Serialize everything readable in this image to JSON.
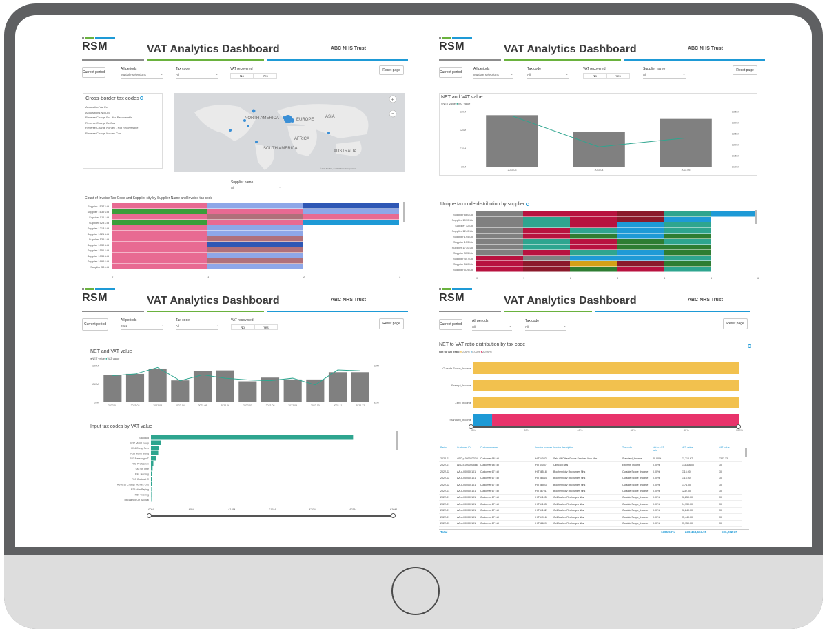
{
  "brand": {
    "logo": "RSM",
    "colors": {
      "grey": "#8d8d8d",
      "green": "#6ab23e",
      "blue": "#1e9ad6",
      "bar": "#808080",
      "line": "#2ea58f"
    }
  },
  "panels": [
    {
      "title": "VAT Analytics Dashboard",
      "trust": "ABC NHS Trust",
      "current_period_btn": "Current period",
      "reset_btn": "Reset page",
      "filters": [
        {
          "label": "All periods",
          "value": "Multiple selections"
        },
        {
          "label": "Tax code",
          "value": "All"
        }
      ],
      "vat_recovered": {
        "label": "VAT recovered",
        "options": [
          "No",
          "Yes"
        ]
      },
      "cross_border": {
        "title": "Cross-border tax codes",
        "items": [
          "Acquisition Vat Ec",
          "Acquisitions Non-ec",
          "Reverse Charge Ec - Not Recoverable",
          "Reverse Charge Ec Cos",
          "Reverse Charge Non-ec - Not Recoverable",
          "Reverse Charge Non-ec Cos"
        ]
      },
      "map_labels": [
        "NORTH AMERICA",
        "EUROPE",
        "ASIA",
        "AFRICA",
        "SOUTH AMERICA",
        "AUSTRALIA"
      ],
      "map_copyright": "© 2023 TomTom, © 2023 Microsoft Corporation",
      "supplier_filter": {
        "label": "Supplier name",
        "value": "All"
      },
      "stack_title": "Count of Invoice Tax Code and Supplier city by Supplier Name and Invoice tax code",
      "stack_rows": [
        "Supplier 1137 Ltd",
        "Supplier 1639 Ltd",
        "Supplier 511 Ltd",
        "Supplier 523 Ltd",
        "Supplier 1213 Ltd",
        "Supplier 1021 Ltd",
        "Supplier 135 Ltd",
        "Supplier 1030 Ltd",
        "Supplier 1551 Ltd",
        "Supplier 1035 Ltd",
        "Supplier 1695 Ltd",
        "Supplier 33 Ltd"
      ],
      "stack_axis": [
        "0",
        "1",
        "2",
        "3"
      ]
    },
    {
      "title": "VAT Analytics Dashboard",
      "trust": "ABC NHS Trust",
      "current_period_btn": "Current period",
      "reset_btn": "Reset page",
      "filters": [
        {
          "label": "All periods",
          "value": "Multiple selections"
        },
        {
          "label": "Tax code",
          "value": "All"
        },
        {
          "label": "Supplier name",
          "value": "All"
        }
      ],
      "vat_recovered": {
        "label": "VAT recovered",
        "options": [
          "No",
          "Yes"
        ]
      },
      "chart_title": "NET and VAT value",
      "legend": [
        "NET value",
        "VAT value"
      ],
      "unique_title": "Unique tax code distribution by supplier",
      "unique_rows": [
        "Supplier 860 Ltd",
        "Supplier 1090 Ltd",
        "Supplier 12 Ltd",
        "Supplier 1240 Ltd",
        "Supplier 195 Ltd",
        "Supplier 153 Ltd",
        "Supplier 1730 Ltd",
        "Supplier 335 Ltd",
        "Supplier 447 Ltd",
        "Supplier 580 Ltd",
        "Supplier 579 Ltd"
      ],
      "unique_axis": [
        "0",
        "1",
        "2",
        "3",
        "4",
        "5",
        "6"
      ]
    },
    {
      "title": "VAT Analytics Dashboard",
      "trust": "ABC NHS Trust",
      "current_period_btn": "Current period",
      "reset_btn": "Reset page",
      "filters": [
        {
          "label": "All periods",
          "value": "2022"
        },
        {
          "label": "Tax code",
          "value": "All"
        }
      ],
      "vat_recovered": {
        "label": "VAT recovered",
        "options": [
          "No",
          "Yes"
        ]
      },
      "chart_title": "NET and VAT value",
      "legend": [
        "NET value",
        "VAT value"
      ],
      "hbar_title": "Input tax codes by VAT value",
      "hbar_rows": [
        "Standard",
        "R37 Maint Equip",
        "R14 Comp Serv",
        "R35 Maint Bldng",
        "R47 Passenger T",
        "R42 Profession",
        "Out Of Time",
        "R41 Nursing",
        "R13 Contract C",
        "Reverse Charge Non-ec Cos",
        "R25 Hire Paying",
        "R50 Training",
        "Reclaimed On Accrual"
      ],
      "hbar_axis": [
        "£0M",
        "£5M",
        "£10M",
        "£15M",
        "£20M",
        "£25M",
        "£30M"
      ]
    },
    {
      "title": "VAT Analytics Dashboard",
      "trust": "ABC NHS Trust",
      "current_period_btn": "Current period",
      "reset_btn": "Reset page",
      "filters": [
        {
          "label": "All periods",
          "value": "All"
        },
        {
          "label": "Tax code",
          "value": "All"
        }
      ],
      "ratio_title": "NET to VAT ratio distribution by tax code",
      "ratio_legend": {
        "label": "Net to VAT ratio",
        "items": [
          "0.00%",
          "5.00%",
          "20.00%"
        ]
      },
      "ratio_rows": [
        "Outside Scope_Income",
        "Exempt_Income",
        "Zero_Income",
        "Standard_Income"
      ],
      "ratio_axis": [
        "0%",
        "20%",
        "40%",
        "60%",
        "80%",
        "100%"
      ],
      "table": {
        "columns": [
          "Period",
          "Customer ID",
          "Customer name",
          "Invoice number",
          "Invoice description",
          "Tax code",
          "Net to VAT ratio",
          "NET value",
          "VAT value"
        ],
        "rows": [
          [
            "2022-01",
            "ABC-p-000032374",
            "Customer 68 Ltd",
            "HIT54082",
            "Sale Of Other Goods Services Non Nhs",
            "Standard_Income",
            "20.00%",
            "£1,710.67",
            "£342.13"
          ],
          [
            "2022-01",
            "ABC-p-000000586",
            "Customer 68 Ltd",
            "HIT54087",
            "Clinical Trials",
            "Exempt_Income",
            "0.00%",
            "£13,316.00",
            "£0"
          ],
          [
            "2022-02",
            "AA-o-000000101",
            "Customer 67 Ltd",
            "HIT56518",
            "Biochemistry Recharges Nhs",
            "Outside Scope_Income",
            "0.00%",
            "£116.00",
            "£0"
          ],
          [
            "2022-02",
            "AA-o-000000101",
            "Customer 67 Ltd",
            "HIT56544",
            "Biochemistry Recharges Nhs",
            "Outside Scope_Income",
            "0.00%",
            "£116.00",
            "£0"
          ],
          [
            "2022-02",
            "AA-o-000000101",
            "Customer 67 Ltd",
            "HIT56503",
            "Biochemistry Recharges Nhs",
            "Outside Scope_Income",
            "0.00%",
            "£174.00",
            "£0"
          ],
          [
            "2022-03",
            "AA-o-000000101",
            "Customer 67 Ltd",
            "HIT58701",
            "Biochemistry Recharges Nhs",
            "Outside Scope_Income",
            "0.00%",
            "£232.00",
            "£0"
          ],
          [
            "2022-01",
            "AA-o-000000101",
            "Customer 67 Ltd",
            "HIT54105",
            "Cell Marker Recharges Nhs",
            "Outside Scope_Income",
            "0.00%",
            "£6,250.00",
            "£0"
          ],
          [
            "2022-01",
            "AA-o-000000101",
            "Customer 67 Ltd",
            "HIT54133",
            "Cell Marker Recharges Nhs",
            "Outside Scope_Income",
            "0.00%",
            "£4,130.00",
            "£0"
          ],
          [
            "2022-01",
            "AA-o-000000101",
            "Customer 67 Ltd",
            "HIT54152",
            "Cell Marker Recharges Nhs",
            "Outside Scope_Income",
            "0.00%",
            "£6,240.00",
            "£0"
          ],
          [
            "2022-01",
            "AA-o-000000101",
            "Customer 67 Ltd",
            "HIT54916",
            "Cell Marker Recharges Nhs",
            "Outside Scope_Income",
            "0.00%",
            "£5,440.00",
            "£0"
          ],
          [
            "2022-03",
            "AA-o-000000101",
            "Customer 67 Ltd",
            "HIT58609",
            "Cell Marker Recharges Nhs",
            "Outside Scope_Income",
            "0.00%",
            "£3,950.00",
            "£0"
          ]
        ],
        "total": {
          "label": "Total",
          "ratio": "1305.50%",
          "net": "£30,458,663.95",
          "vat": "£96,262.77"
        }
      }
    }
  ],
  "chart_data": [
    {
      "type": "bar",
      "title": "NET and VAT value",
      "categories": [
        "2022-03",
        "2022-04",
        "2022-05"
      ],
      "series": [
        {
          "name": "NET value",
          "type": "bar",
          "values": [
            28,
            19,
            26
          ]
        },
        {
          "name": "VAT value",
          "type": "line",
          "values": [
            3.3,
            1.9,
            2.3
          ]
        }
      ],
      "y_left_ticks": [
        "£0M",
        "£10M",
        "£20M",
        "£30M"
      ],
      "y_right_ticks": [
        "£1.0M",
        "£1.5M",
        "£2.0M",
        "£2.5M",
        "£3.0M",
        "£3.5M"
      ]
    },
    {
      "type": "bar",
      "title": "NET and VAT value",
      "categories": [
        "2022-01",
        "2022-02",
        "2022-03",
        "2022-04",
        "2022-05",
        "2022-06",
        "2022-07",
        "2022-08",
        "2022-09",
        "2022-10",
        "2022-11",
        "2022-12"
      ],
      "series": [
        {
          "name": "NET value",
          "type": "bar",
          "values": [
            15,
            15.5,
            18.5,
            12,
            17,
            17.5,
            11.5,
            13.5,
            12.5,
            12.5,
            16.5,
            16.5
          ]
        },
        {
          "name": "VAT value",
          "type": "line",
          "values": [
            3.2,
            3.4,
            4.2,
            2.6,
            3.3,
            2.9,
            2.7,
            2.6,
            2.9,
            2.1,
            3.9,
            3.8
          ]
        }
      ],
      "y_left_ticks": [
        "£0M",
        "£10M",
        "£20M"
      ],
      "y_right_ticks": [
        "£2M",
        "£4M"
      ]
    },
    {
      "type": "bar",
      "title": "Input tax codes by VAT value",
      "orientation": "horizontal",
      "categories": [
        "Standard",
        "R37 Maint Equip",
        "R14 Comp Serv",
        "R35 Maint Bldng",
        "R47 Passenger T",
        "R42 Profession",
        "Out Of Time",
        "R41 Nursing",
        "R13 Contract C",
        "Reverse Charge Non-ec Cos",
        "R25 Hire Paying",
        "R50 Training",
        "Reclaimed On Accrual"
      ],
      "values": [
        25,
        1.2,
        1.0,
        0.9,
        0.6,
        0.3,
        0.2,
        0.1,
        0.1,
        0.1,
        0.05,
        0.05,
        0.02
      ],
      "xlim": [
        0,
        30
      ]
    },
    {
      "type": "bar",
      "title": "NET to VAT ratio distribution by tax code",
      "orientation": "horizontal-stacked-100",
      "categories": [
        "Outside Scope_Income",
        "Exempt_Income",
        "Zero_Income",
        "Standard_Income"
      ],
      "series": [
        {
          "name": "0.00%",
          "values": [
            100,
            100,
            100,
            0
          ]
        },
        {
          "name": "5.00%",
          "values": [
            0,
            0,
            0,
            7
          ]
        },
        {
          "name": "20.00%",
          "values": [
            0,
            0,
            0,
            93
          ]
        }
      ]
    }
  ]
}
